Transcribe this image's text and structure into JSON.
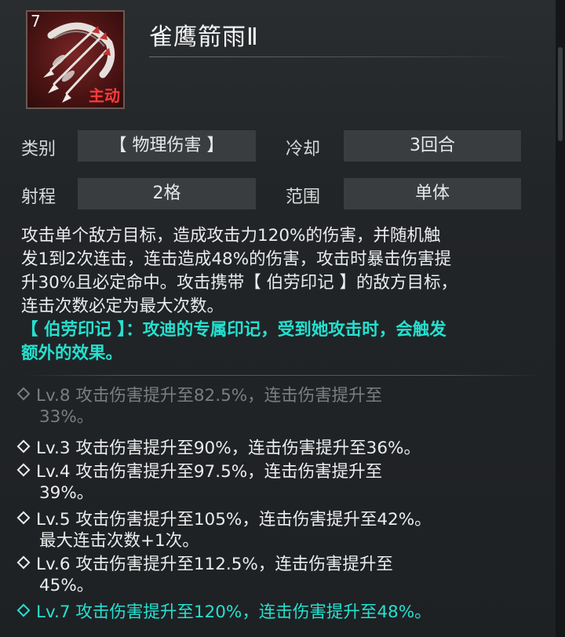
{
  "skill": {
    "level_badge": "7",
    "type_badge": "主动",
    "title": "雀鹰箭雨Ⅱ",
    "icon": "arrow-volley-icon"
  },
  "attributes": {
    "category_label": "类别",
    "category_value": "【 物理伤害 】",
    "cooldown_label": "冷却",
    "cooldown_value": "3回合",
    "range_label": "射程",
    "range_value": "2格",
    "area_label": "范围",
    "area_value": "单体"
  },
  "description": {
    "lines": [
      "攻击单个敌方目标，造成攻击力120%的伤害，并随机触",
      "发1到2次连击，连击造成48%的伤害，攻击时暴击伤害提",
      "升30%且必定命中。攻击携带【 伯劳印记 】的敌方目标，",
      "连击次数必定为最大次数。"
    ],
    "highlight_lines": [
      "【 伯劳印记 】：攻迪的专属印记，受到她攻击时，会触发",
      "额外的效果。"
    ]
  },
  "levels": [
    {
      "line1": "Lv.8 攻击伤害提升至82.5%，连击伤害提升至",
      "line2": "33%。",
      "state": "locked"
    },
    {
      "line1": "Lv.3 攻击伤害提升至90%，连击伤害提升至36%。",
      "line2": "",
      "state": "unlocked"
    },
    {
      "line1": "Lv.4 攻击伤害提升至97.5%，连击伤害提升至",
      "line2": "39%。",
      "state": "unlocked"
    },
    {
      "line1": "Lv.5 攻击伤害提升至105%，连击伤害提升至42%。",
      "line2": "最大连击次数+1次。",
      "state": "unlocked"
    },
    {
      "line1": "Lv.6 攻击伤害提升至112.5%，连击伤害提升至",
      "line2": "45%。",
      "state": "unlocked"
    },
    {
      "line1": "Lv.7 攻击伤害提升至120%，连击伤害提升至48%。",
      "line2": "",
      "state": "current"
    }
  ],
  "colors": {
    "accent_teal": "#25e0cf",
    "type_red": "#ff3b3b",
    "locked_gray": "#7b7e81"
  }
}
